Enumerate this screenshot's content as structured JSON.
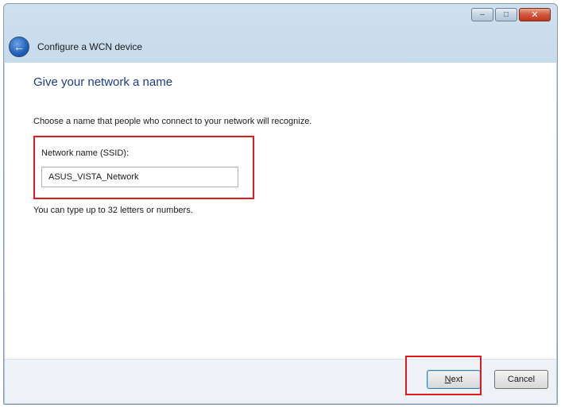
{
  "window": {
    "title": "Configure a WCN device",
    "caption_buttons": {
      "minimize": "–",
      "maximize": "□",
      "close": "✕"
    }
  },
  "page": {
    "heading": "Give your network a name",
    "instructions": "Choose a name that people who connect to your network will recognize.",
    "ssid": {
      "label": "Network name (SSID):",
      "value": "ASUS_VISTA_Network"
    },
    "hint": "You can type up to 32 letters or numbers."
  },
  "footer": {
    "next_mnemonic": "N",
    "next_rest": "ext",
    "cancel_label": "Cancel"
  },
  "icons": {
    "back": "back-arrow-icon"
  },
  "colors": {
    "heading": "#1b3b8a",
    "highlight": "#e01b1b"
  }
}
